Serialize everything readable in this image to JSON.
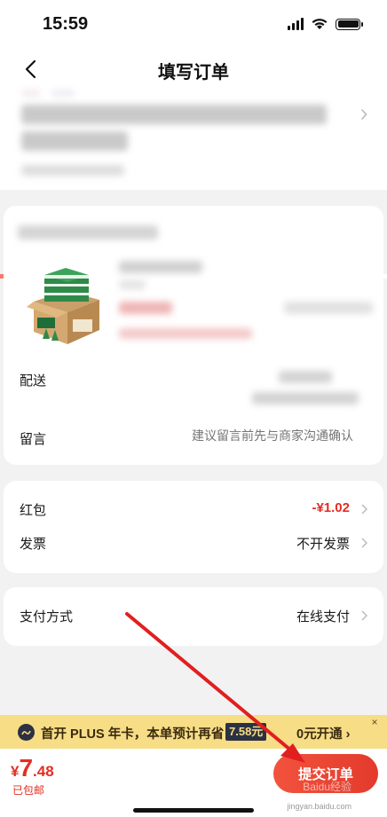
{
  "status_bar": {
    "time": "15:59"
  },
  "nav": {
    "title": "填写订单",
    "back_icon": "chevron-left-icon"
  },
  "product_card": {
    "delivery_label": "配送",
    "message_label": "留言",
    "message_placeholder": "建议留言前先与商家沟通确认"
  },
  "coupons": {
    "redpacket_label": "红包",
    "redpacket_value": "-¥1.02",
    "invoice_label": "发票",
    "invoice_value": "不开发票"
  },
  "payment": {
    "label": "支付方式",
    "value": "在线支付"
  },
  "plus_banner": {
    "text": "首开 PLUS 年卡，本单预计再省",
    "saving": "7.58元",
    "action": "0元开通 ›",
    "close": "×"
  },
  "checkout": {
    "currency": "¥",
    "price_int": "7",
    "price_dec": ".48",
    "free_shipping": "已包邮",
    "submit_label": "提交订单"
  },
  "watermark": {
    "brand": "Baidu经验",
    "url": "jingyan.baidu.com"
  },
  "colors": {
    "accent_red": "#e22e22",
    "plus_gold": "#f6dd86",
    "plus_dark": "#2c3142"
  }
}
